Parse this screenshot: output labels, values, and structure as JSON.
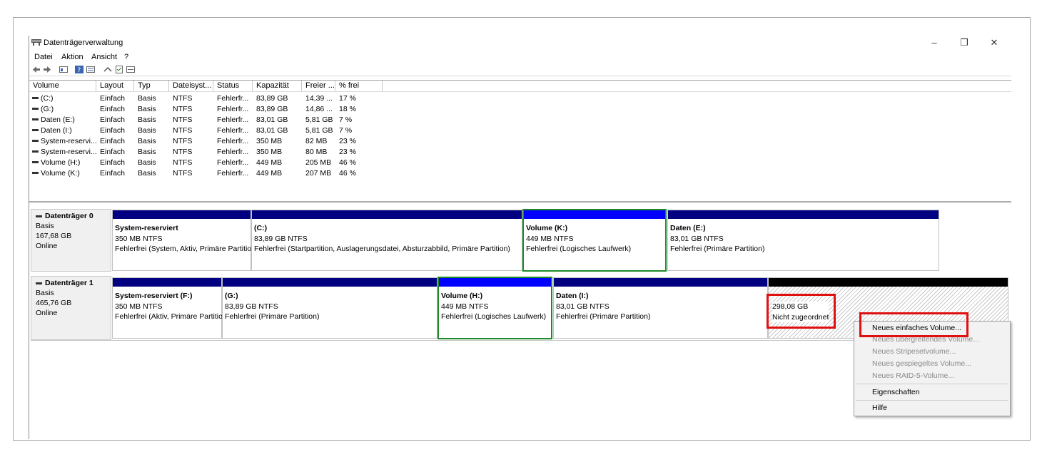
{
  "window": {
    "title": "Datenträgerverwaltung",
    "buttons": {
      "minimize": "–",
      "maximize": "❐",
      "close": "✕"
    }
  },
  "menu": [
    "Datei",
    "Aktion",
    "Ansicht",
    "?"
  ],
  "list": {
    "columns": [
      "Volume",
      "Layout",
      "Typ",
      "Dateisyst...",
      "Status",
      "Kapazität",
      "Freier ...",
      "% frei"
    ],
    "rows": [
      [
        "(C:)",
        "Einfach",
        "Basis",
        "NTFS",
        "Fehlerfr...",
        "83,89 GB",
        "14,39 ...",
        "17 %"
      ],
      [
        "(G:)",
        "Einfach",
        "Basis",
        "NTFS",
        "Fehlerfr...",
        "83,89 GB",
        "14,86 ...",
        "18 %"
      ],
      [
        "Daten (E:)",
        "Einfach",
        "Basis",
        "NTFS",
        "Fehlerfr...",
        "83,01 GB",
        "5,81 GB",
        "7 %"
      ],
      [
        "Daten (I:)",
        "Einfach",
        "Basis",
        "NTFS",
        "Fehlerfr...",
        "83,01 GB",
        "5,81 GB",
        "7 %"
      ],
      [
        "System-reservi...",
        "Einfach",
        "Basis",
        "NTFS",
        "Fehlerfr...",
        "350 MB",
        "82 MB",
        "23 %"
      ],
      [
        "System-reservi...",
        "Einfach",
        "Basis",
        "NTFS",
        "Fehlerfr...",
        "350 MB",
        "80 MB",
        "23 %"
      ],
      [
        "Volume (H:)",
        "Einfach",
        "Basis",
        "NTFS",
        "Fehlerfr...",
        "449 MB",
        "205 MB",
        "46 %"
      ],
      [
        "Volume (K:)",
        "Einfach",
        "Basis",
        "NTFS",
        "Fehlerfr...",
        "449 MB",
        "207 MB",
        "46 %"
      ]
    ]
  },
  "disks": [
    {
      "name": "Datenträger 0",
      "type": "Basis",
      "size": "167,68 GB",
      "state": "Online",
      "partitions": [
        {
          "name": "System-reserviert",
          "size": "350 MB NTFS",
          "status": "Fehlerfrei (System, Aktiv, Primäre Partition)"
        },
        {
          "name": "(C:)",
          "size": "83,89 GB NTFS",
          "status": "Fehlerfrei (Startpartition, Auslagerungsdatei, Absturzabbild, Primäre Partition)"
        },
        {
          "name": "Volume  (K:)",
          "size": "449 MB NTFS",
          "status": "Fehlerfrei (Logisches Laufwerk)"
        },
        {
          "name": "Daten  (E:)",
          "size": "83,01 GB NTFS",
          "status": "Fehlerfrei (Primäre Partition)"
        }
      ]
    },
    {
      "name": "Datenträger 1",
      "type": "Basis",
      "size": "465,76 GB",
      "state": "Online",
      "partitions": [
        {
          "name": "System-reserviert  (F:)",
          "size": "350 MB NTFS",
          "status": "Fehlerfrei (Aktiv, Primäre Partition)"
        },
        {
          "name": "(G:)",
          "size": "83,89 GB NTFS",
          "status": "Fehlerfrei (Primäre Partition)"
        },
        {
          "name": "Volume  (H:)",
          "size": "449 MB NTFS",
          "status": "Fehlerfrei (Logisches Laufwerk)"
        },
        {
          "name": "Daten  (I:)",
          "size": "83,01 GB NTFS",
          "status": "Fehlerfrei (Primäre Partition)"
        }
      ],
      "unallocated": {
        "size": "298,08 GB",
        "label": "Nicht zugeordnet"
      }
    }
  ],
  "context_menu": {
    "items": [
      {
        "label": "Neues einfaches Volume...",
        "enabled": true
      },
      {
        "label": "Neues übergreifendes Volume...",
        "enabled": false
      },
      {
        "label": "Neues Stripesetvolume...",
        "enabled": false
      },
      {
        "label": "Neues gespiegeltes Volume...",
        "enabled": false
      },
      {
        "label": "Neues RAID-5-Volume...",
        "enabled": false
      },
      {
        "label": "Eigenschaften",
        "enabled": true
      },
      {
        "label": "Hilfe",
        "enabled": true
      }
    ]
  },
  "colors": {
    "primary_partition_bar": "#000080",
    "selected_partition_bar": "#0000ff",
    "selected_border": "#1f8a2a",
    "highlight": "#e01010",
    "unallocated_bar": "#000000"
  }
}
